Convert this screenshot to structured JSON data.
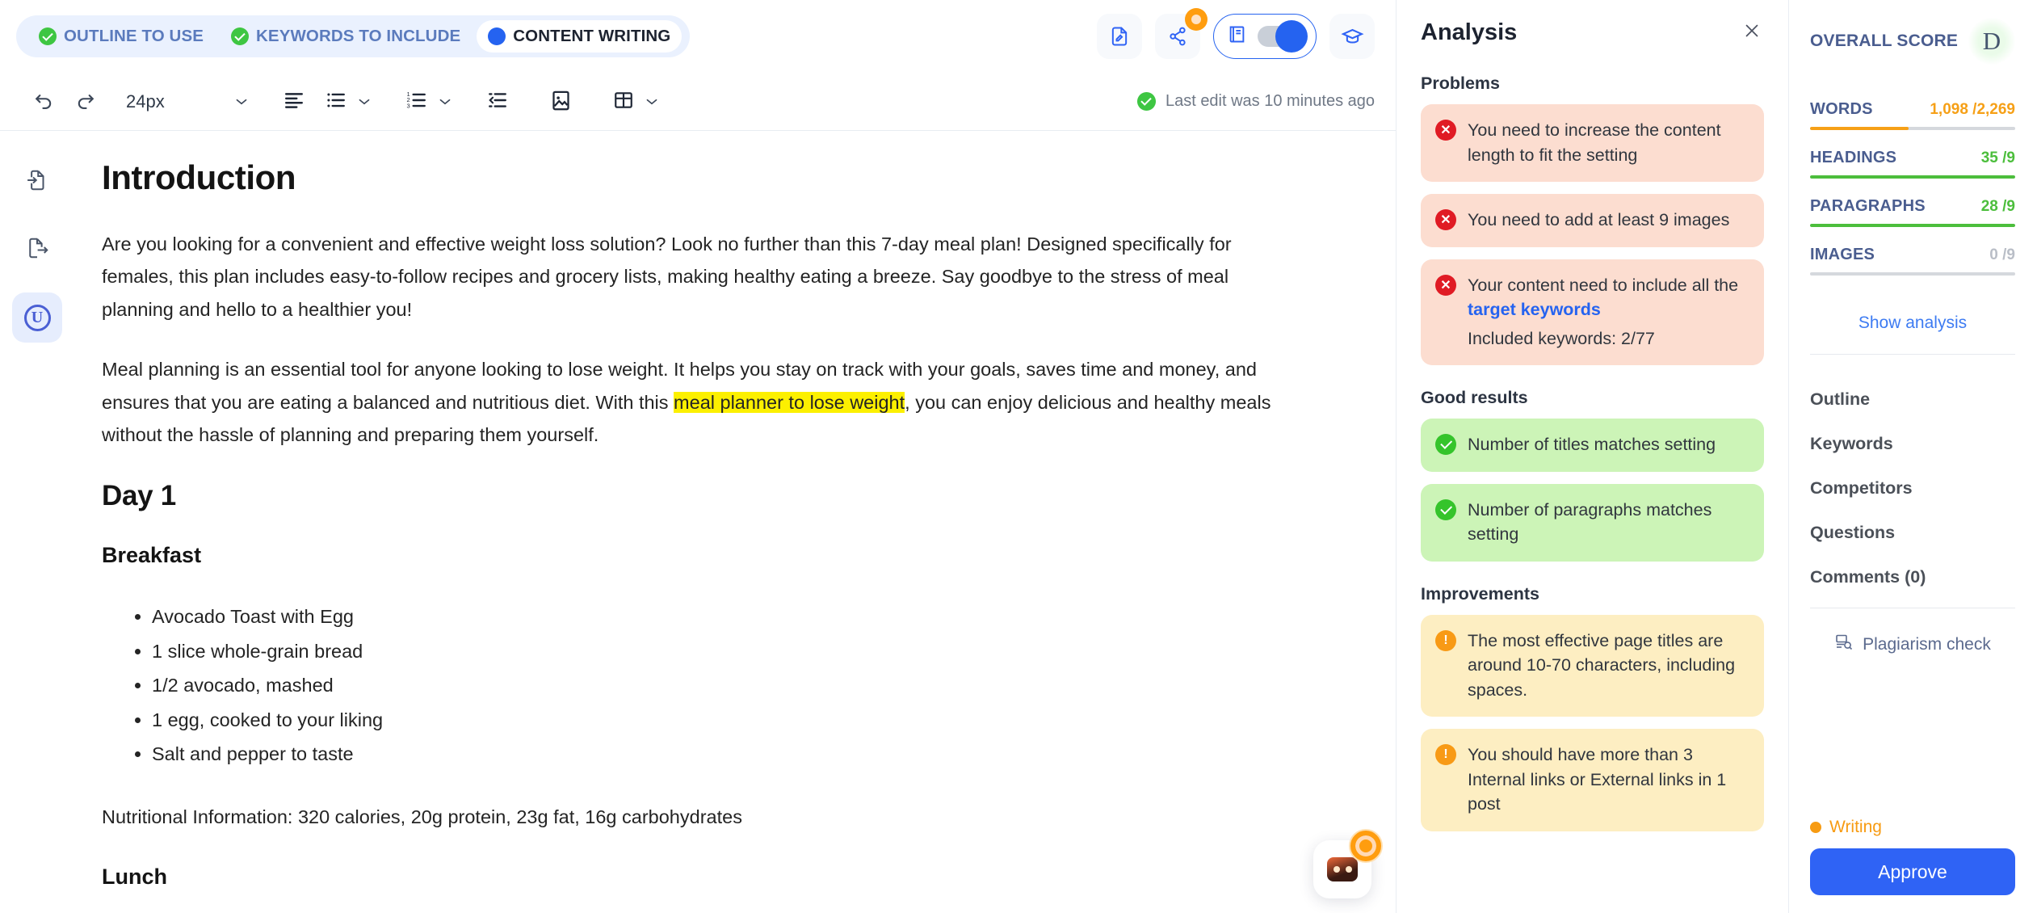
{
  "steps": [
    {
      "label": "OUTLINE TO USE",
      "state": "done",
      "icon": "check-circle-icon"
    },
    {
      "label": "KEYWORDS TO INCLUDE",
      "state": "done",
      "icon": "check-circle-icon"
    },
    {
      "label": "CONTENT WRITING",
      "state": "current",
      "icon": "dot-icon"
    }
  ],
  "top_actions": [
    {
      "name": "document-edit-icon",
      "badge": false
    },
    {
      "name": "share-icon",
      "badge": true
    },
    {
      "name": "reader-toggle",
      "badge": false
    },
    {
      "name": "graduation-cap-icon",
      "badge": false
    }
  ],
  "toolbar": {
    "undo": "undo-icon",
    "redo": "redo-icon",
    "font_size": "24px",
    "align": "align-left-icon",
    "bullet_list": "bullet-list-icon",
    "numbered_list": "numbered-list-icon",
    "indent": "indent-icon",
    "image": "image-icon",
    "table": "table-icon",
    "status": "Last edit was 10 minutes ago"
  },
  "rail": [
    {
      "name": "import-doc-icon",
      "active": false
    },
    {
      "name": "export-doc-icon",
      "active": false
    },
    {
      "name": "unique-badge-icon",
      "label": "U",
      "active": true
    }
  ],
  "document": {
    "h1": "Introduction",
    "p1": "Are you looking for a convenient and effective weight loss solution? Look no further than this 7-day meal plan! Designed specifically for females, this plan includes easy-to-follow recipes and grocery lists, making healthy eating a breeze. Say goodbye to the stress of meal planning and hello to a healthier you!",
    "p2_before": "Meal planning is an essential tool for anyone looking to lose weight. It helps you stay on track with your goals, saves time and money, and ensures that you are eating a balanced and nutritious diet. With this ",
    "p2_highlight": "meal planner to lose weight",
    "p2_after": ", you can enjoy delicious and healthy meals without the hassle of planning and preparing them yourself.",
    "h2_day": "Day 1",
    "h3_breakfast": "Breakfast",
    "breakfast_items": [
      "Avocado Toast with Egg",
      "1 slice whole-grain bread",
      "1/2 avocado, mashed",
      "1 egg, cooked to your liking",
      "Salt and pepper to taste"
    ],
    "nutrition": "Nutritional Information: 320 calories, 20g protein, 23g fat, 16g carbohydrates",
    "h3_lunch": "Lunch"
  },
  "chat_widget": {
    "name": "support-chat-icon",
    "badge": true
  },
  "analysis": {
    "title": "Analysis",
    "close": "close-icon",
    "problems_label": "Problems",
    "problems": [
      {
        "text": "You need to increase the content length to fit the setting"
      },
      {
        "text": "You need to add at least 9 images"
      },
      {
        "text": "Your content need to include all the ",
        "link": "target keywords",
        "sub": "Included keywords: 2/77"
      }
    ],
    "good_label": "Good results",
    "good": [
      {
        "text": "Number of titles matches setting"
      },
      {
        "text": "Number of paragraphs matches setting"
      }
    ],
    "improvements_label": "Improvements",
    "improvements": [
      {
        "text": "The most effective page titles are around 10-70 characters, including spaces."
      },
      {
        "text": "You should have more than 3 Internal links or External links in 1 post"
      }
    ]
  },
  "score": {
    "overall_label": "OVERALL SCORE",
    "grade": "D",
    "metrics": [
      {
        "name": "WORDS",
        "value": "1,098 /2,269",
        "percent": 48,
        "color": "orange"
      },
      {
        "name": "HEADINGS",
        "value": "35 /9",
        "percent": 100,
        "color": "green"
      },
      {
        "name": "PARAGRAPHS",
        "value": "28 /9",
        "percent": 100,
        "color": "green"
      },
      {
        "name": "IMAGES",
        "value": "0 /9",
        "percent": 0,
        "color": "grey"
      }
    ],
    "show_analysis": "Show analysis",
    "nav": [
      "Outline",
      "Keywords",
      "Competitors",
      "Questions",
      "Comments (0)"
    ],
    "plagiarism": "Plagiarism check",
    "status": "Writing",
    "approve": "Approve"
  },
  "colors": {
    "accent": "#2563f0",
    "orange": "#f6a017",
    "green": "#4cbe3c",
    "red": "#e01b24",
    "highlight": "#fcf000"
  }
}
